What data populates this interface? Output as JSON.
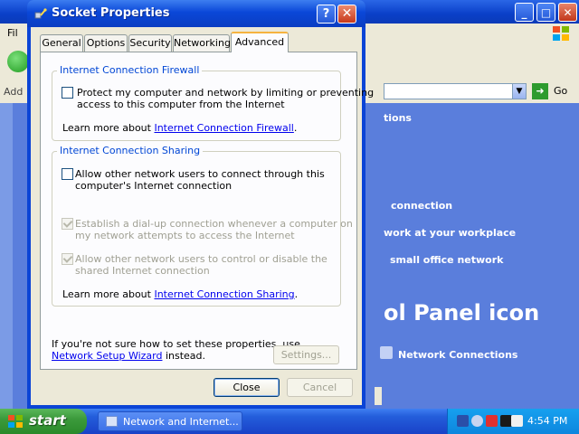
{
  "background_window": {
    "menu_partial": "Fil",
    "address_label_partial": "Add",
    "go_label": "Go",
    "tasks": [
      "tions",
      "connection",
      "work at your workplace",
      "small office network"
    ],
    "big_title_partial": "ol Panel icon",
    "network_connections_label": "Network Connections"
  },
  "dialog": {
    "title": "Socket Properties",
    "help_glyph": "?",
    "close_glyph": "✕",
    "tabs": [
      {
        "label": "General",
        "active": false
      },
      {
        "label": "Options",
        "active": false
      },
      {
        "label": "Security",
        "active": false
      },
      {
        "label": "Networking",
        "active": false
      },
      {
        "label": "Advanced",
        "active": true
      }
    ],
    "firewall": {
      "group_label": "Internet Connection Firewall",
      "checkbox_line1": "Protect my computer and network by limiting or preventing",
      "checkbox_line2": "access to this computer from the Internet",
      "checked": false,
      "learn_prefix": "Learn more about ",
      "learn_link": "Internet Connection Firewall",
      "learn_suffix": "."
    },
    "sharing": {
      "group_label": "Internet Connection Sharing",
      "allow_line1": "Allow other network users to connect through this",
      "allow_line2": "computer's Internet connection",
      "allow_checked": false,
      "dialup_line1": "Establish a dial-up connection whenever a computer on",
      "dialup_line2": "my network attempts to access the Internet",
      "dialup_checked": true,
      "control_line1": "Allow other network users to control or disable the",
      "control_line2": "shared Internet connection",
      "control_checked": true,
      "learn_prefix": "Learn more about ",
      "learn_link": "Internet Connection Sharing",
      "learn_suffix": "."
    },
    "note_line1": "If you're not sure how to set these properties, use",
    "note_link": "Network Setup Wizard",
    "note_suffix": " instead.",
    "settings_button": "Settings...",
    "close_button": "Close",
    "cancel_button": "Cancel"
  },
  "taskbar": {
    "start_label": "start",
    "task_button_label": "Network and Internet...",
    "clock": "4:54 PM"
  },
  "colors": {
    "xp_blue": "#0a47d8",
    "tab_highlight": "#f6b33f",
    "group_label": "#0046d5",
    "start_green": "#3c9a3c"
  }
}
